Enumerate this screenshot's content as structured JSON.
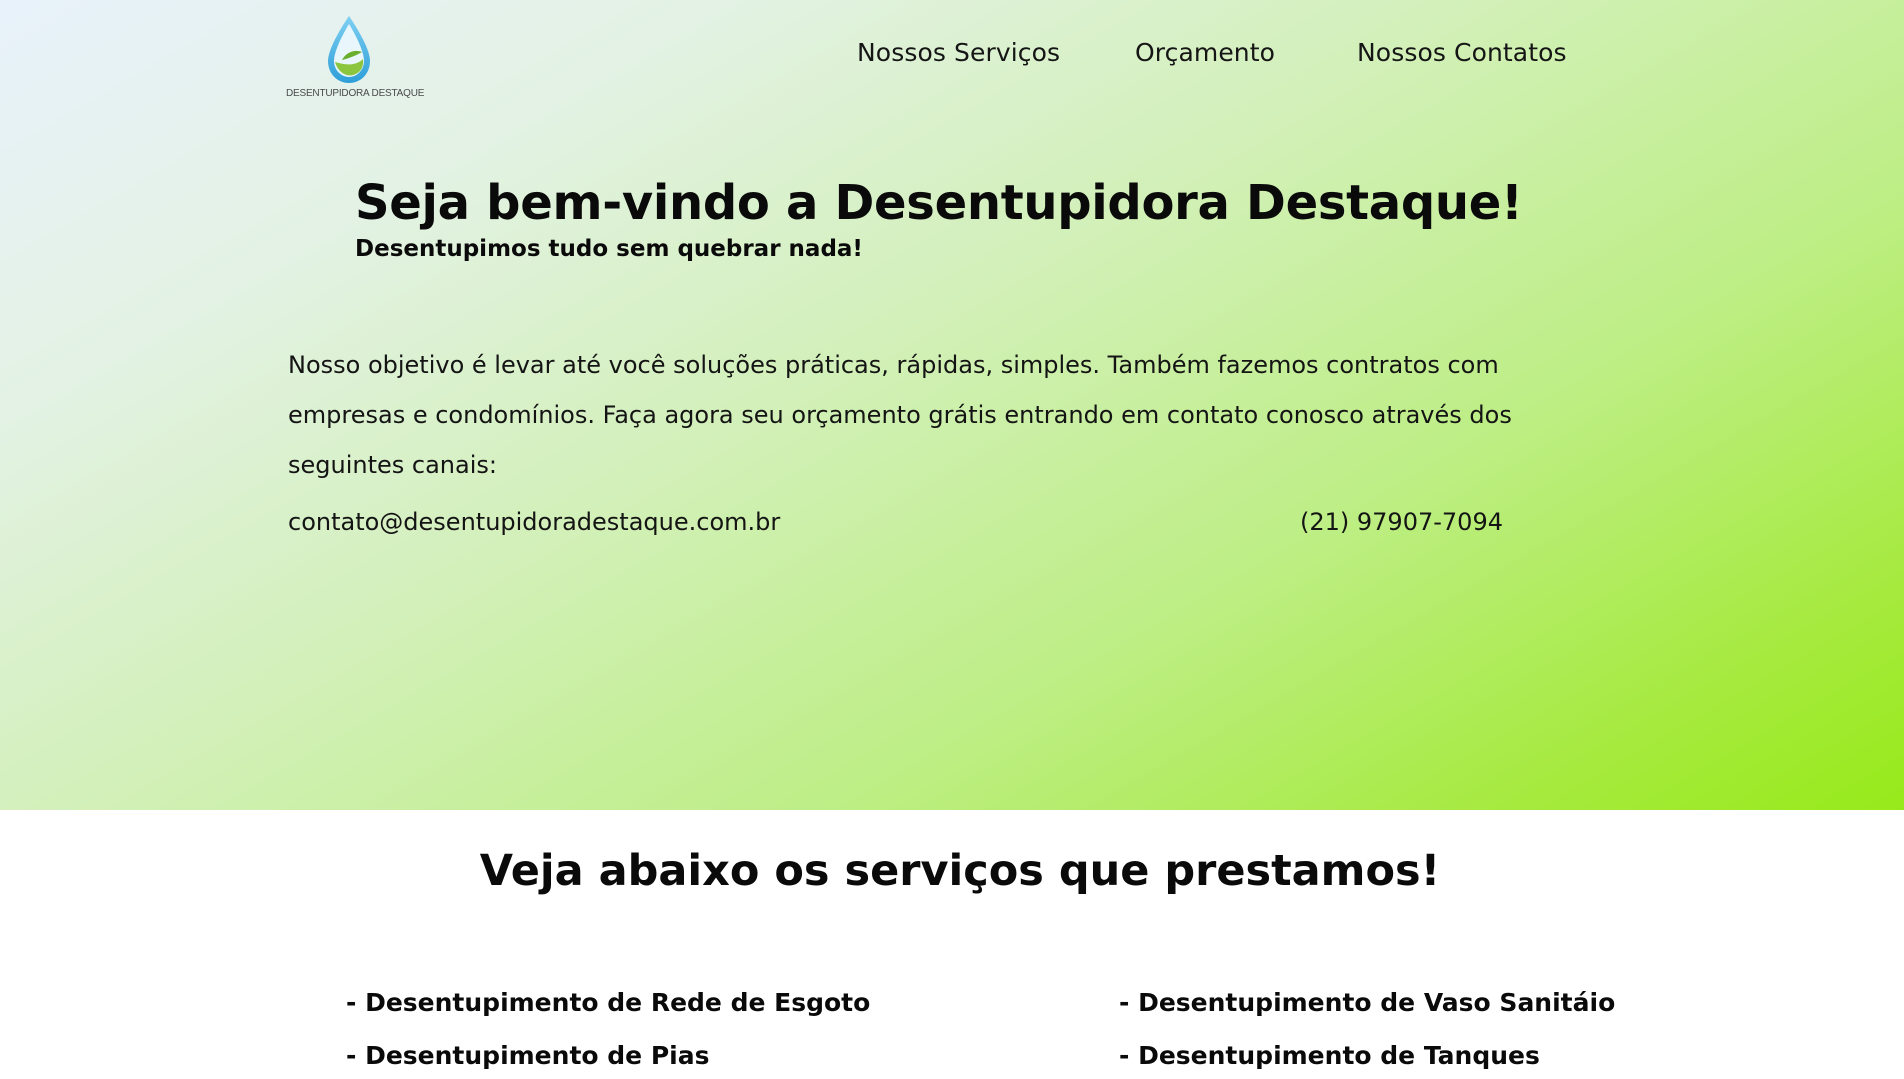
{
  "header": {
    "logo_text": "DESENTUPIDORA DESTAQUE",
    "nav": [
      {
        "label": "Nossos Serviços"
      },
      {
        "label": "Orçamento"
      },
      {
        "label": "Nossos Contatos"
      }
    ]
  },
  "hero": {
    "title": "Seja bem-vindo a Desentupidora Destaque!",
    "subtitle": "Desentupimos tudo sem quebrar nada!",
    "description": "Nosso objetivo é levar até você soluções práticas, rápidas, simples. Também fazemos contratos com empresas e condomínios. Faça agora seu orçamento grátis entrando em contato conosco através dos seguintes canais:",
    "email": "contato@desentupidoradestaque.com.br",
    "phone": "(21) 97907-7094"
  },
  "services": {
    "title": "Veja abaixo os serviços que prestamos!",
    "items": [
      "- Desentupimento de Rede de Esgoto",
      "- Desentupimento de Vaso Sanitáio",
      "- Desentupimento de Pias",
      "- Desentupimento de Tanques"
    ]
  },
  "colors": {
    "gradient_start": "#e8f2fb",
    "gradient_end": "#97ea1a",
    "logo_drop": "#4bb3e6",
    "logo_leaf": "#8cc63f"
  }
}
